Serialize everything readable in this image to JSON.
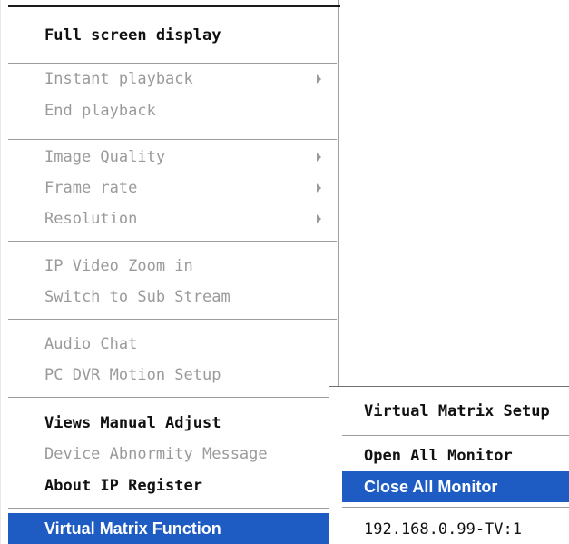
{
  "context_menu": {
    "items": [
      {
        "label": "Full screen display",
        "enabled": true,
        "bold": true,
        "has_submenu": false
      },
      {
        "label": "Instant playback",
        "enabled": false,
        "has_submenu": true
      },
      {
        "label": "End playback",
        "enabled": false,
        "has_submenu": false
      },
      {
        "label": "Image Quality",
        "enabled": false,
        "has_submenu": true
      },
      {
        "label": "Frame rate",
        "enabled": false,
        "has_submenu": true
      },
      {
        "label": "Resolution",
        "enabled": false,
        "has_submenu": true
      },
      {
        "label": "IP Video Zoom in",
        "enabled": false,
        "has_submenu": false
      },
      {
        "label": "Switch to Sub Stream",
        "enabled": false,
        "has_submenu": false
      },
      {
        "label": "Audio Chat",
        "enabled": false,
        "has_submenu": false
      },
      {
        "label": "PC DVR Motion Setup",
        "enabled": false,
        "has_submenu": false
      },
      {
        "label": "Views Manual Adjust",
        "enabled": true,
        "bold": true,
        "has_submenu": false
      },
      {
        "label": "Device Abnormity Message",
        "enabled": false,
        "has_submenu": false
      },
      {
        "label": "About IP Register",
        "enabled": true,
        "bold": true,
        "has_submenu": false
      },
      {
        "label": "Virtual Matrix Function",
        "enabled": true,
        "highlighted": true,
        "has_submenu": true
      }
    ]
  },
  "submenu": {
    "items": [
      {
        "label": "Virtual Matrix Setup",
        "enabled": true,
        "bold": true
      },
      {
        "label": "Open All Monitor",
        "enabled": true,
        "bold": true
      },
      {
        "label": "Close All Monitor",
        "enabled": true,
        "highlighted": true
      },
      {
        "label": "192.168.0.99-TV:1",
        "enabled": true
      }
    ]
  },
  "colors": {
    "highlight": "#1e5cc4",
    "disabled_text": "#9a9a9a",
    "enabled_text": "#111111"
  }
}
